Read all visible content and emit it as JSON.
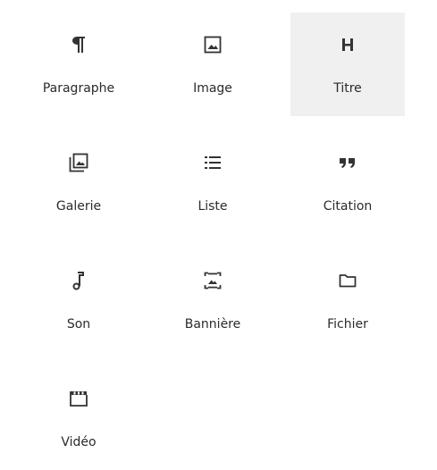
{
  "blocks": [
    {
      "label": "Paragraphe",
      "icon": "paragraph-icon"
    },
    {
      "label": "Image",
      "icon": "image-icon"
    },
    {
      "label": "Titre",
      "icon": "heading-icon",
      "active": true
    },
    {
      "label": "Galerie",
      "icon": "gallery-icon"
    },
    {
      "label": "Liste",
      "icon": "list-icon"
    },
    {
      "label": "Citation",
      "icon": "quote-icon"
    },
    {
      "label": "Son",
      "icon": "audio-icon"
    },
    {
      "label": "Bannière",
      "icon": "cover-icon"
    },
    {
      "label": "Fichier",
      "icon": "file-icon"
    },
    {
      "label": "Vidéo",
      "icon": "video-icon"
    }
  ],
  "colors": {
    "icon": "#333333",
    "label": "#2b2b2b",
    "active_background": "#f0f0f0"
  }
}
